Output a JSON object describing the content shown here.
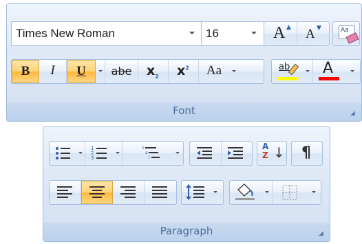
{
  "font_group": {
    "title": "Font",
    "font_name": "Times New Roman",
    "font_size": "16",
    "grow_font": "A",
    "shrink_font": "A",
    "clear_formatting": "Aa",
    "bold": "B",
    "italic": "I",
    "underline": "U",
    "strikethrough": "abe",
    "subscript": "x",
    "subscript_mark": "2",
    "superscript": "x",
    "superscript_mark": "2",
    "change_case": "Aa",
    "highlight": "ab",
    "font_color": "A"
  },
  "paragraph_group": {
    "title": "Paragraph",
    "sort_top": "A",
    "sort_bottom": "Z",
    "show_marks": "¶"
  },
  "colors": {
    "highlight_bar": "#ffff00",
    "font_color_bar": "#ff0000",
    "active_button": "#ffc04a",
    "group_title": "#4e6e9e"
  }
}
